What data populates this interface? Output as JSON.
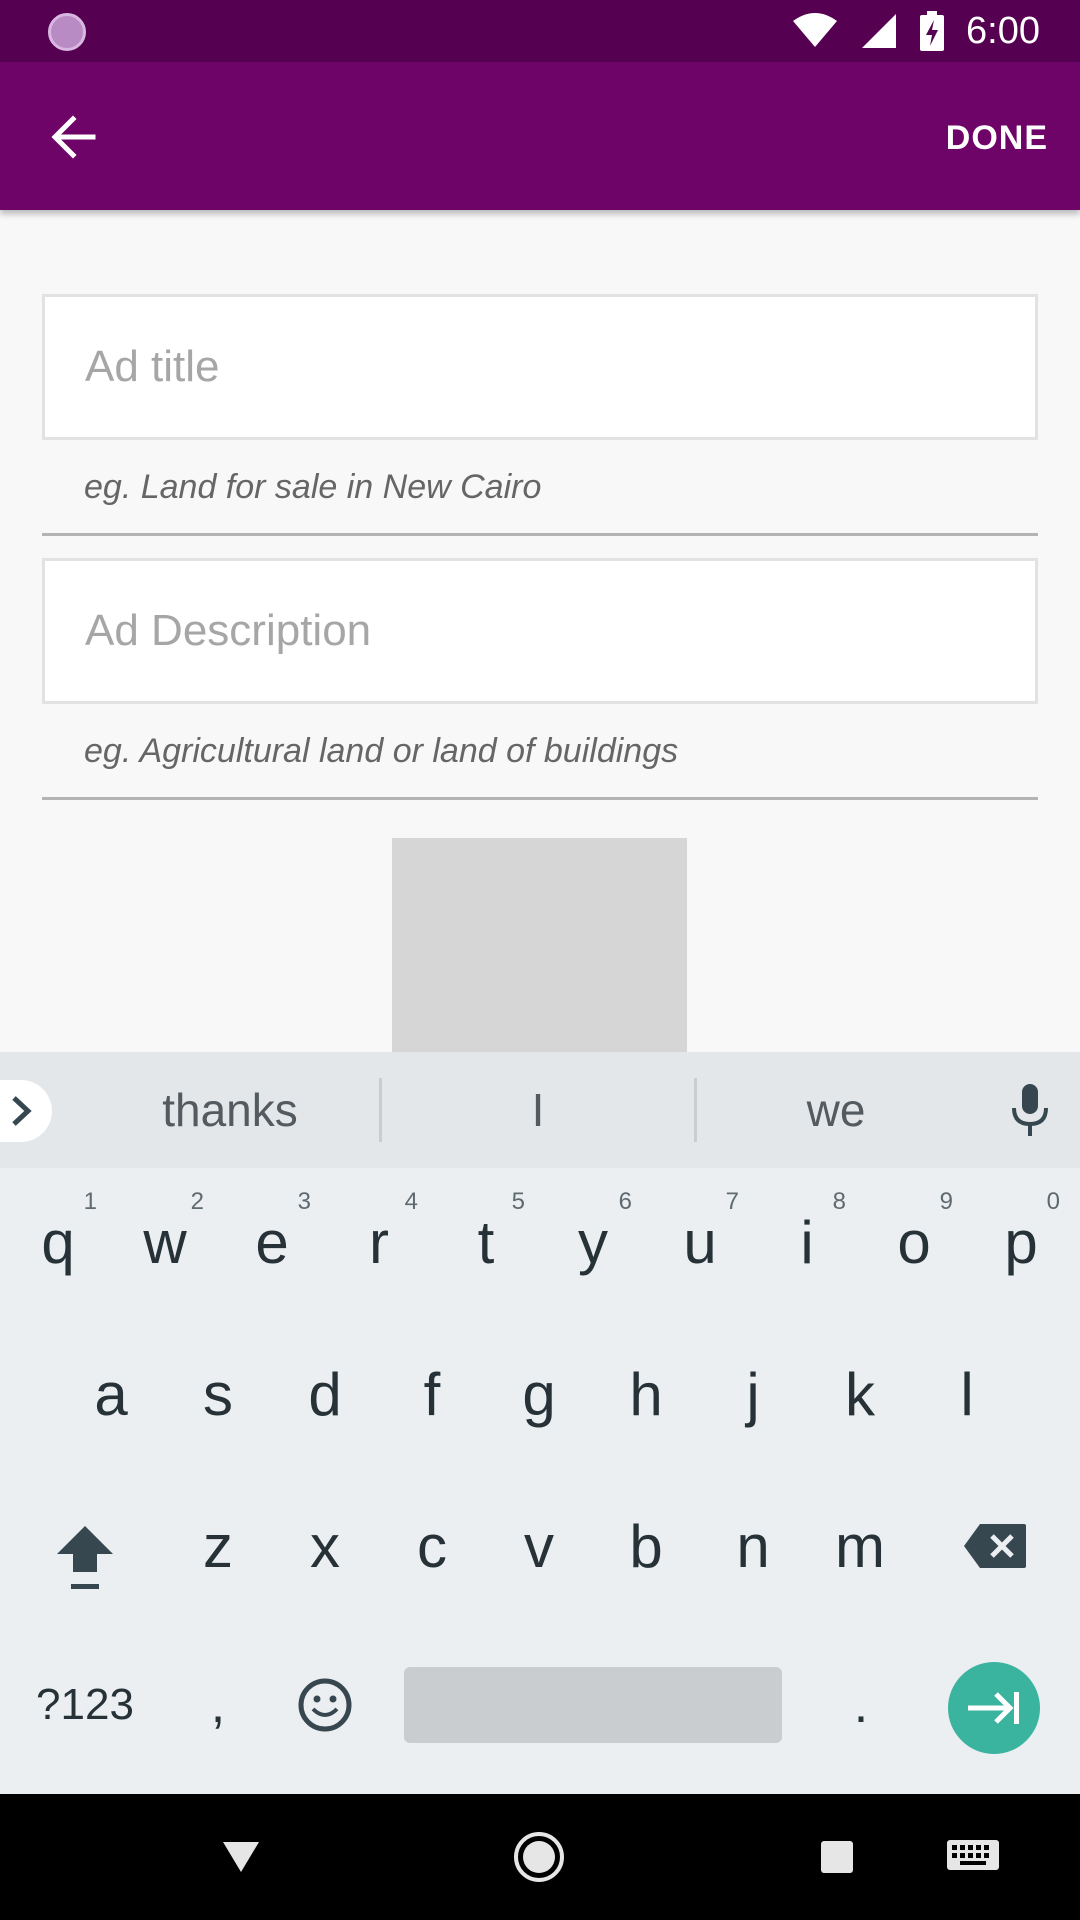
{
  "status_bar": {
    "time": "6:00",
    "icons": [
      "loading-icon",
      "wifi-icon",
      "cell-signal-icon",
      "battery-charging-icon"
    ]
  },
  "app_bar": {
    "back_icon": "arrow-back-icon",
    "done_label": "DONE",
    "background": "#6f0468"
  },
  "form": {
    "title_field": {
      "placeholder": "Ad title",
      "value": "",
      "hint": "eg. Land for sale in New Cairo"
    },
    "description_field": {
      "placeholder": "Ad Description",
      "value": "",
      "hint": "eg. Agricultural land or land of buildings"
    }
  },
  "keyboard": {
    "suggestions": [
      "thanks",
      "I",
      "we"
    ],
    "row1": [
      "q",
      "w",
      "e",
      "r",
      "t",
      "y",
      "u",
      "i",
      "o",
      "p"
    ],
    "row1_hints": [
      "1",
      "2",
      "3",
      "4",
      "5",
      "6",
      "7",
      "8",
      "9",
      "0"
    ],
    "row2": [
      "a",
      "s",
      "d",
      "f",
      "g",
      "h",
      "j",
      "k",
      "l"
    ],
    "row3": [
      "z",
      "x",
      "c",
      "v",
      "b",
      "n",
      "m"
    ],
    "symbols_label": "?123",
    "comma_label": ",",
    "period_label": ".",
    "enter_color": "#3ab39f"
  },
  "nav_bar": {
    "icons": [
      "back-triangle-icon",
      "home-circle-icon",
      "recents-square-icon",
      "keyboard-icon"
    ]
  }
}
